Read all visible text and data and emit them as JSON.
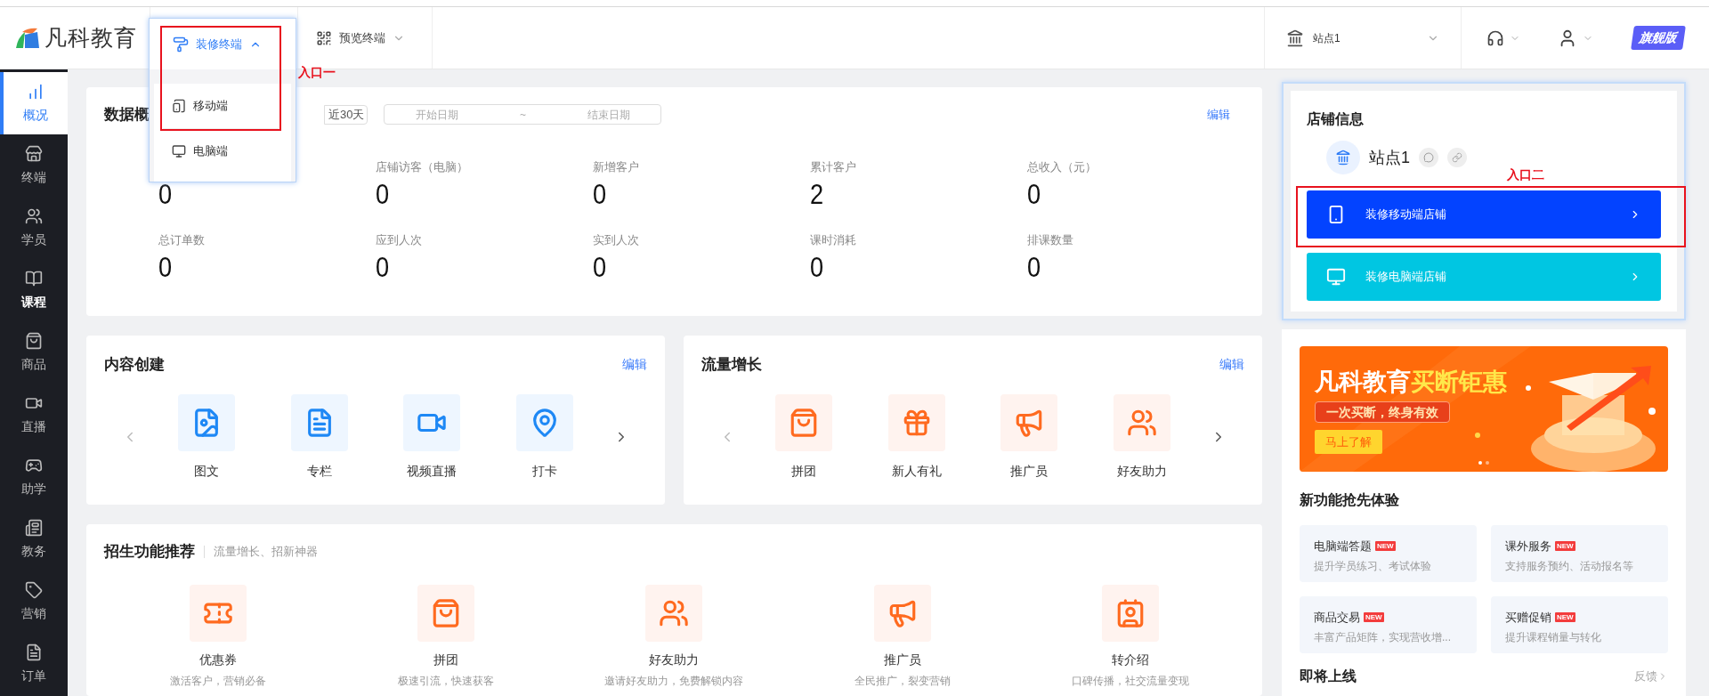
{
  "header": {
    "logo": "凡科教育",
    "menus": [
      {
        "label": "装修终端",
        "expanded": true
      },
      {
        "label": "预览终端",
        "expanded": false
      }
    ],
    "site": "站点1",
    "edition": "旗舰版"
  },
  "dropdown": {
    "items": [
      {
        "label": "移动端",
        "kind": "mobile"
      },
      {
        "label": "电脑端",
        "kind": "desktop"
      }
    ]
  },
  "annotations": [
    "入口一",
    "入口二"
  ],
  "sidebar": {
    "items": [
      {
        "label": "概况",
        "selected": true,
        "hovered": false
      },
      {
        "label": "终端",
        "selected": false,
        "hovered": false
      },
      {
        "label": "学员",
        "selected": false,
        "hovered": false
      },
      {
        "label": "课程",
        "selected": false,
        "hovered": true
      },
      {
        "label": "商品",
        "selected": false,
        "hovered": false
      },
      {
        "label": "直播",
        "selected": false,
        "hovered": false
      },
      {
        "label": "助学",
        "selected": false,
        "hovered": false
      },
      {
        "label": "教务",
        "selected": false,
        "hovered": false
      },
      {
        "label": "营销",
        "selected": false,
        "hovered": false
      },
      {
        "label": "订单",
        "selected": false,
        "hovered": false
      }
    ]
  },
  "overview": {
    "title": "数据概",
    "range": "近30天",
    "start_placeholder": "开始日期",
    "separator": "~",
    "end_placeholder": "结束日期",
    "edit": "编辑",
    "stats": [
      {
        "value": "0"
      },
      {
        "label": "店铺访客（电脑）",
        "value": "0"
      },
      {
        "label": "新增客户",
        "value": "0"
      },
      {
        "label": "累计客户",
        "value": "2"
      },
      {
        "label": "总收入（元）",
        "value": "0"
      },
      {
        "label": "总订单数",
        "value": "0"
      },
      {
        "label": "应到人次",
        "value": "0"
      },
      {
        "label": "实到人次",
        "value": "0"
      },
      {
        "label": "课时消耗",
        "value": "0"
      },
      {
        "label": "排课数量",
        "value": "0"
      }
    ]
  },
  "content_creation": {
    "title": "内容创建",
    "edit": "编辑",
    "items": [
      "图文",
      "专栏",
      "视频直播",
      "打卡"
    ]
  },
  "traffic_growth": {
    "title": "流量增长",
    "edit": "编辑",
    "items": [
      "拼团",
      "新人有礼",
      "推广员",
      "好友助力"
    ]
  },
  "recruitment": {
    "title": "招生功能推荐",
    "subtitle": "流量增长、招新神器",
    "items": [
      {
        "title": "优惠券",
        "desc": "激活客户，营销必备"
      },
      {
        "title": "拼团",
        "desc": "极速引流，快速获客"
      },
      {
        "title": "好友助力",
        "desc": "邀请好友助力，免费解锁内容"
      },
      {
        "title": "推广员",
        "desc": "全民推广，裂变营销"
      },
      {
        "title": "转介绍",
        "desc": "口碑传播，社交流量变现"
      }
    ]
  },
  "store": {
    "title": "店铺信息",
    "name": "站点1",
    "buttons": [
      {
        "label": "装修移动端店铺",
        "kind": "mobile"
      },
      {
        "label": "装修电脑端店铺",
        "kind": "desktop"
      }
    ]
  },
  "banner": {
    "title": [
      "凡科教育",
      "买断钜惠"
    ],
    "tagline": "一次买断，终身有效",
    "cta": "马上了解"
  },
  "new_features": {
    "title": "新功能抢先体验",
    "items": [
      {
        "title": "电脑端答题",
        "badge": "NEW",
        "desc": "提升学员练习、考试体验"
      },
      {
        "title": "课外服务",
        "badge": "NEW",
        "desc": "支持服务预约、活动报名等"
      },
      {
        "title": "商品交易",
        "badge": "NEW",
        "desc": "丰富产品矩阵，实现营收增..."
      },
      {
        "title": "买赠促销",
        "badge": "NEW",
        "desc": "提升课程销量与转化"
      }
    ]
  },
  "upcoming": {
    "title": "即将上线",
    "link": "反馈"
  }
}
